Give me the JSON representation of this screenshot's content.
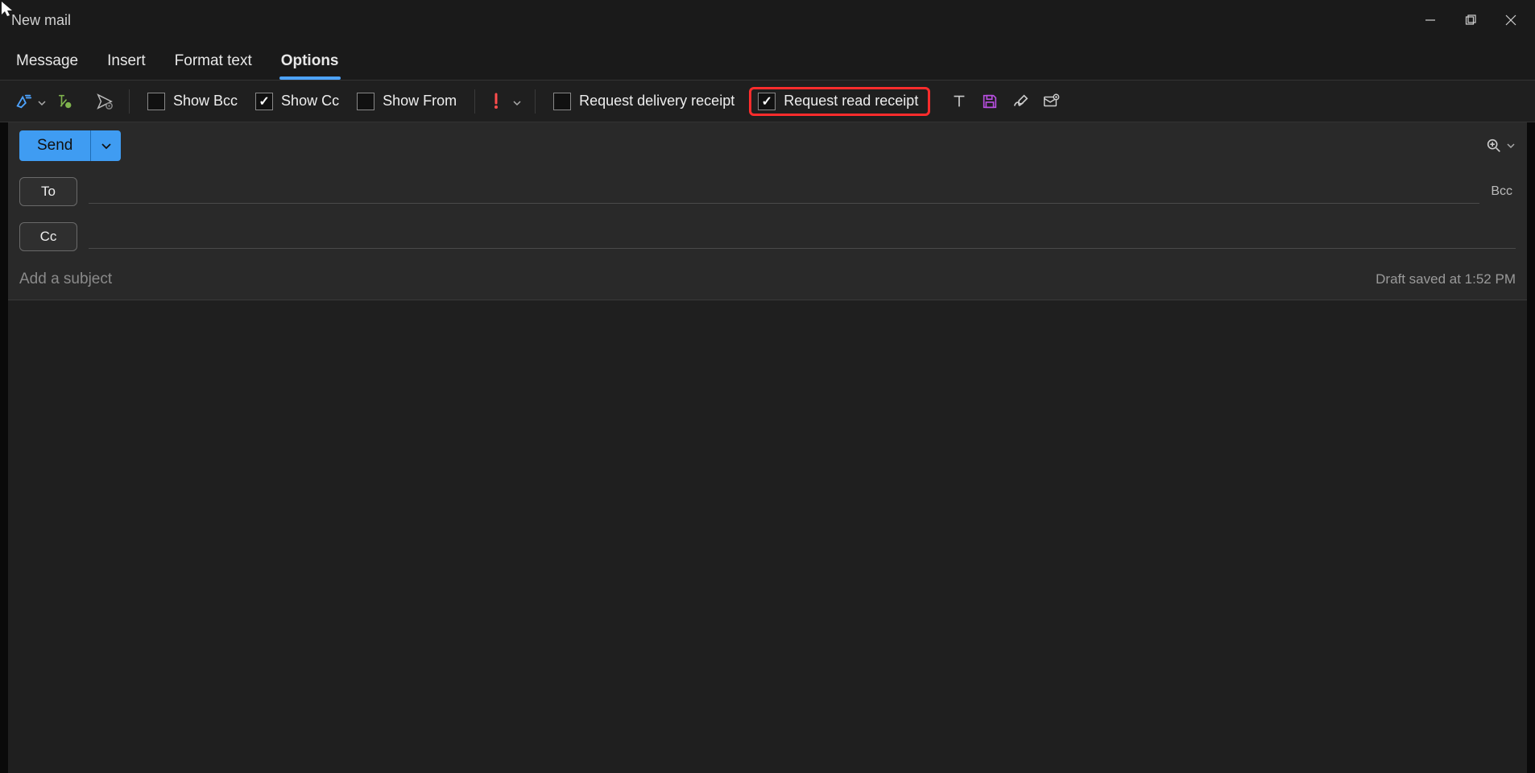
{
  "window": {
    "title": "New mail"
  },
  "tabs": {
    "message": "Message",
    "insert": "Insert",
    "format_text": "Format text",
    "options": "Options",
    "active": "options"
  },
  "ribbon": {
    "show_bcc": {
      "label": "Show Bcc",
      "checked": false
    },
    "show_cc": {
      "label": "Show Cc",
      "checked": true
    },
    "show_from": {
      "label": "Show From",
      "checked": false
    },
    "request_delivery": {
      "label": "Request delivery receipt",
      "checked": false
    },
    "request_read": {
      "label": "Request read receipt",
      "checked": true
    }
  },
  "compose": {
    "send_label": "Send",
    "to_label": "To",
    "cc_label": "Cc",
    "bcc_link": "Bcc",
    "subject_placeholder": "Add a subject",
    "subject_value": "",
    "draft_status": "Draft saved at 1:52 PM"
  },
  "colors": {
    "accent": "#3f9cf2",
    "highlight_border": "#ff2c2c",
    "save_icon": "#b84fe0"
  }
}
